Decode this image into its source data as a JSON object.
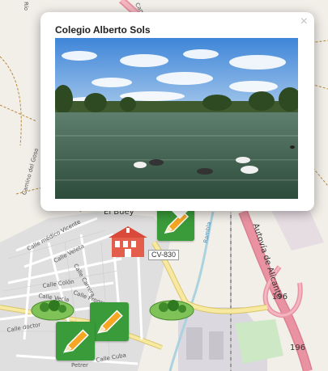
{
  "popup": {
    "title": "Colegio Alberto Sols",
    "close_glyph": "×",
    "photo_icon": "lake-photo"
  },
  "map": {
    "place_label": "El Buey",
    "road_shield": "CV-830",
    "highway_label": "Autovía de Alicante",
    "highway_number_1": "196",
    "highway_number_2": "196",
    "top_road_label": "Camino",
    "street_labels": {
      "camino_del_goso": "Camino del Goso",
      "rio_label": "Río",
      "medico": "Calle médico Vicente",
      "veleta": "Calle Veleta",
      "colon": "Calle Colón",
      "carrera": "Calle Carrera",
      "vecia": "Calle Vecia",
      "progreso": "Calle Progreso",
      "doctor": "Calle doctor",
      "rambla": "Rambla",
      "petrer": "Petrer",
      "cuba": "Calle Cuba"
    }
  },
  "markers": [
    {
      "type": "edit",
      "icon": "pencil-icon"
    },
    {
      "type": "school",
      "icon": "school-icon"
    },
    {
      "type": "park",
      "icon": "park-icon"
    },
    {
      "type": "park",
      "icon": "park-icon"
    },
    {
      "type": "edit",
      "icon": "pencil-icon"
    },
    {
      "type": "edit",
      "icon": "pencil-icon"
    }
  ]
}
